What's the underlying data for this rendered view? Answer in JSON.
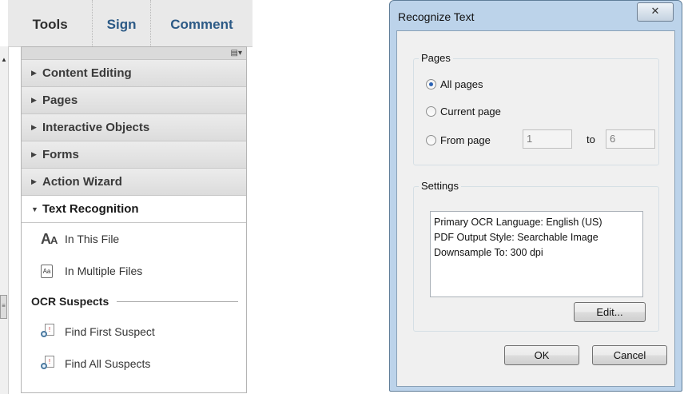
{
  "tools_pane": {
    "tabs": [
      {
        "label": "Tools"
      },
      {
        "label": "Sign"
      },
      {
        "label": "Comment"
      }
    ],
    "sections": [
      {
        "label": "Content Editing"
      },
      {
        "label": "Pages"
      },
      {
        "label": "Interactive Objects"
      },
      {
        "label": "Forms"
      },
      {
        "label": "Action Wizard"
      },
      {
        "label": "Text Recognition"
      }
    ],
    "text_recognition_items": [
      {
        "label": "In This File",
        "icon": "text-aa-icon"
      },
      {
        "label": "In Multiple Files",
        "icon": "multiple-files-icon"
      }
    ],
    "ocr_suspects": {
      "heading": "OCR Suspects",
      "items": [
        {
          "label": "Find First Suspect",
          "icon": "find-suspect-icon"
        },
        {
          "label": "Find All Suspects",
          "icon": "find-suspects-icon"
        }
      ]
    }
  },
  "dialog": {
    "title": "Recognize Text",
    "close_glyph": "✕",
    "pages": {
      "label": "Pages",
      "options": [
        {
          "label": "All pages",
          "selected": true
        },
        {
          "label": "Current page",
          "selected": false
        },
        {
          "label": "From page",
          "selected": false
        }
      ],
      "from_value": "1",
      "to_label": "to",
      "to_value": "6"
    },
    "settings": {
      "label": "Settings",
      "lines": [
        "Primary OCR Language: English (US)",
        "PDF Output Style: Searchable Image",
        "Downsample To: 300 dpi"
      ],
      "edit_label": "Edit..."
    },
    "ok_label": "OK",
    "cancel_label": "Cancel"
  }
}
